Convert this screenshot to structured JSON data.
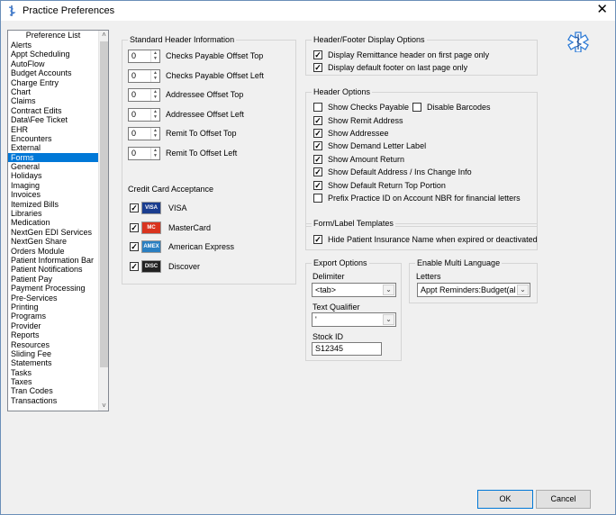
{
  "window": {
    "title": "Practice Preferences",
    "app_icon": "staff-of-aesculapius-icon",
    "close_icon": "close-icon"
  },
  "preference_list": {
    "header": "Preference List",
    "items": [
      "Alerts",
      "Appt Scheduling",
      "AutoFlow",
      "Budget Accounts",
      "Charge Entry",
      "Chart",
      "Claims",
      "Contract Edits",
      "Data\\Fee Ticket",
      "EHR",
      "Encounters",
      "External",
      "Forms",
      "General",
      "Holidays",
      "Imaging",
      "Invoices",
      "Itemized Bills",
      "Libraries",
      "Medication",
      "NextGen EDI Services",
      "NextGen Share",
      "Orders Module",
      "Patient Information Bar",
      "Patient Notifications",
      "Patient Pay",
      "Payment Processing",
      "Pre-Services",
      "Printing",
      "Programs",
      "Provider",
      "Reports",
      "Resources",
      "Sliding Fee",
      "Statements",
      "Tasks",
      "Taxes",
      "Tran Codes",
      "Transactions"
    ],
    "selected": "Forms",
    "scroll_down_icon": "chevron-down-icon"
  },
  "standard_header": {
    "title": "Standard Header Information",
    "offsets": [
      {
        "value": "0",
        "label": "Checks Payable Offset Top"
      },
      {
        "value": "0",
        "label": "Checks Payable Offset Left"
      },
      {
        "value": "0",
        "label": "Addressee Offset Top"
      },
      {
        "value": "0",
        "label": "Addressee Offset Left"
      },
      {
        "value": "0",
        "label": "Remit To Offset Top"
      },
      {
        "value": "0",
        "label": "Remit To Offset Left"
      }
    ],
    "credit_card_title": "Credit Card Acceptance",
    "cards": [
      {
        "label": "VISA",
        "checked": true,
        "icon": "visa-card-icon",
        "icon_text": "VISA",
        "color": "#1a3d8f"
      },
      {
        "label": "MasterCard",
        "checked": true,
        "icon": "mastercard-icon",
        "icon_text": "MC",
        "color": "#d9341f"
      },
      {
        "label": "American Express",
        "checked": true,
        "icon": "amex-card-icon",
        "icon_text": "AMEX",
        "color": "#2a7fc1"
      },
      {
        "label": "Discover",
        "checked": true,
        "icon": "discover-card-icon",
        "icon_text": "DISC",
        "color": "#222222"
      }
    ]
  },
  "header_footer": {
    "title": "Header/Footer Display Options",
    "options": [
      {
        "label": "Display Remittance header on first page only",
        "checked": true
      },
      {
        "label": "Display default footer on last page only",
        "checked": true
      }
    ]
  },
  "header_options": {
    "title": "Header Options",
    "show_checks_payable": {
      "label": "Show Checks Payable",
      "checked": false
    },
    "disable_barcodes": {
      "label": "Disable Barcodes",
      "checked": false
    },
    "options": [
      {
        "label": "Show Remit Address",
        "checked": true
      },
      {
        "label": "Show Addressee",
        "checked": true
      },
      {
        "label": "Show Demand Letter Label",
        "checked": true
      },
      {
        "label": "Show Amount Return",
        "checked": true
      },
      {
        "label": "Show Default Address / Ins Change Info",
        "checked": true
      },
      {
        "label": "Show Default Return Top Portion",
        "checked": true
      },
      {
        "label": "Prefix Practice ID on Account NBR for financial letters",
        "checked": false
      }
    ]
  },
  "form_label_templates": {
    "title": "Form/Label Templates",
    "option": {
      "label": "Hide Patient Insurance Name when expired or deactivated",
      "checked": true
    }
  },
  "export_options": {
    "title": "Export Options",
    "delimiter_label": "Delimiter",
    "delimiter_value": "<tab>",
    "text_qualifier_label": "Text Qualifier",
    "text_qualifier_value": "'",
    "stock_id_label": "Stock ID",
    "stock_id_value": "S12345"
  },
  "multi_language": {
    "title": "Enable Multi Language",
    "letters_label": "Letters",
    "letters_value": "Appt Reminders:Budget(all"
  },
  "buttons": {
    "ok": "OK",
    "cancel": "Cancel"
  },
  "colors": {
    "selection": "#0078d7",
    "window_bg": "#f0f0f0",
    "border": "#6b8fb8"
  },
  "logo_icon": "medical-caduceus-logo-icon"
}
